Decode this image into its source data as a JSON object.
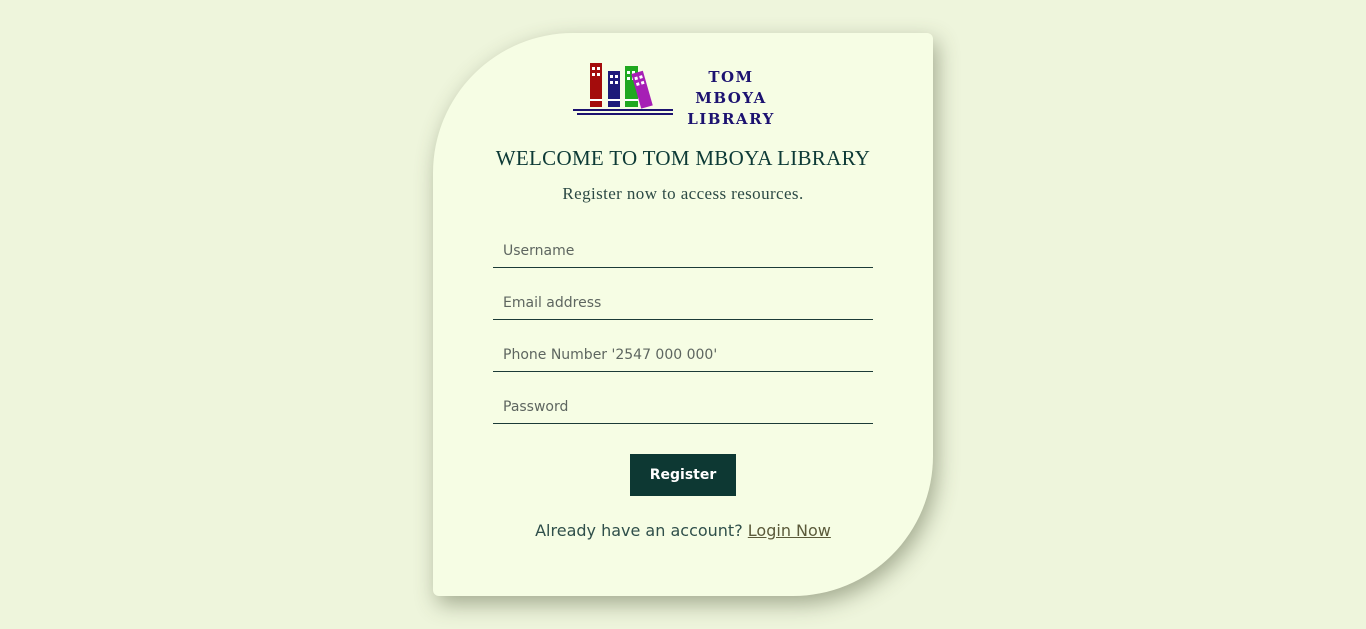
{
  "logo": {
    "line1": "TOM MBOYA",
    "line2": "LIBRARY"
  },
  "title": "WELCOME TO TOM MBOYA LIBRARY",
  "subtitle": "Register now to access resources.",
  "form": {
    "username_placeholder": "Username",
    "email_placeholder": "Email address",
    "phone_placeholder": "Phone Number '2547 000 000'",
    "password_placeholder": "Password",
    "register_label": "Register"
  },
  "footer": {
    "prompt": "Already have an account?",
    "link_label": "Login Now"
  },
  "colors": {
    "page_background": "#eef5dc",
    "card_background": "#f6fde4",
    "accent_dark": "#0d3833",
    "logo_text": "#1c1270"
  }
}
